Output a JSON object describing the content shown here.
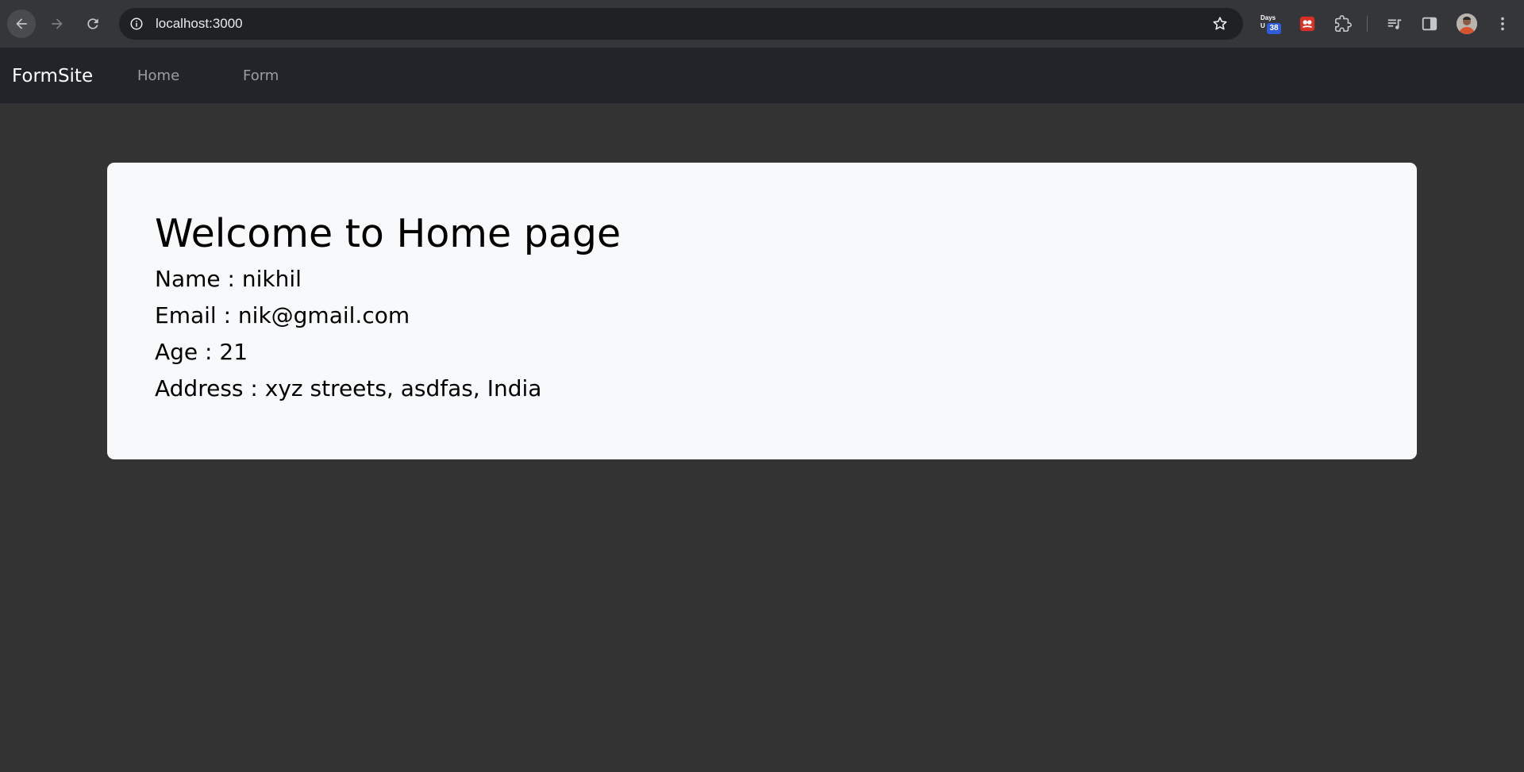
{
  "browser": {
    "url": "localhost:3000",
    "extension_days": {
      "top_label": "Days",
      "side_label": "U",
      "badge": "38"
    },
    "icons": {
      "back": "arrow-left-icon",
      "forward": "arrow-right-icon",
      "reload": "reload-icon",
      "site_info": "info-icon",
      "bookmark": "star-icon",
      "extension_red": "red-extension-icon",
      "extensions": "puzzle-icon",
      "media": "media-control-icon",
      "side_panel": "side-panel-icon",
      "menu": "more-vert-icon"
    }
  },
  "navbar": {
    "brand": "FormSite",
    "links": [
      {
        "label": "Home"
      },
      {
        "label": "Form"
      }
    ]
  },
  "card": {
    "title": "Welcome to Home page",
    "lines": [
      "Name : nikhil",
      "Email : nik@gmail.com",
      "Age : 21",
      "Address : xyz streets, asdfas, India"
    ]
  },
  "colors": {
    "page_background": "#333333",
    "navbar_background": "#212529",
    "card_background": "#f8f9fa",
    "chrome_background": "#35363a"
  }
}
